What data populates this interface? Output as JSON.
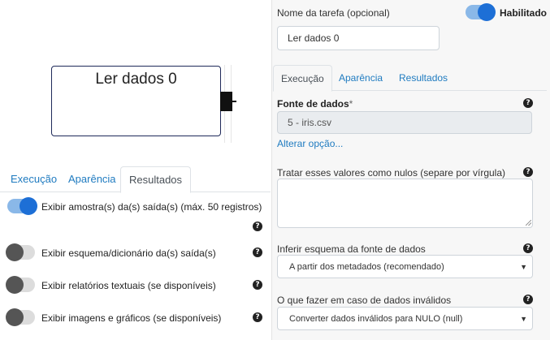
{
  "canvas": {
    "node": {
      "title": "Ler dados 0"
    }
  },
  "left_panel": {
    "tabs": [
      {
        "label": "Execução"
      },
      {
        "label": "Aparência"
      },
      {
        "label": "Resultados",
        "active": true
      }
    ],
    "options": [
      {
        "label": "Exibir amostra(s) da(s) saída(s) (máx. 50 registros)",
        "enabled": true
      },
      {
        "label": "Exibir esquema/dicionário da(s) saída(s)",
        "enabled": false
      },
      {
        "label": "Exibir relatórios textuais (se disponíveis)",
        "enabled": false
      },
      {
        "label": "Exibir imagens e gráficos (se disponíveis)",
        "enabled": false
      }
    ]
  },
  "right_panel": {
    "task_name_label": "Nome da tarefa (opcional)",
    "enabled_label": "Habilitado",
    "enabled": true,
    "task_name_value": "Ler dados 0",
    "tabs": [
      {
        "label": "Execução",
        "active": true
      },
      {
        "label": "Aparência"
      },
      {
        "label": "Resultados"
      }
    ],
    "data_source": {
      "label": "Fonte de dados",
      "required_mark": "*",
      "value": "5 - iris.csv",
      "change_link": "Alterar opção..."
    },
    "null_values": {
      "label": "Tratar esses valores como nulos (separe por vírgula)",
      "value": ""
    },
    "infer_schema": {
      "label": "Inferir esquema da fonte de dados",
      "selected": "A partir dos metadados (recomendado)"
    },
    "invalid_data": {
      "label": "O que fazer em caso de dados inválidos",
      "selected": "Converter dados inválidos para NULO (null)"
    }
  },
  "colors": {
    "accent": "#1d6fd6",
    "link": "#1f7bc0",
    "node_border": "#1f2a5a"
  },
  "icons": [
    "question-circle-icon",
    "caret-down-icon",
    "toggle-switch"
  ]
}
